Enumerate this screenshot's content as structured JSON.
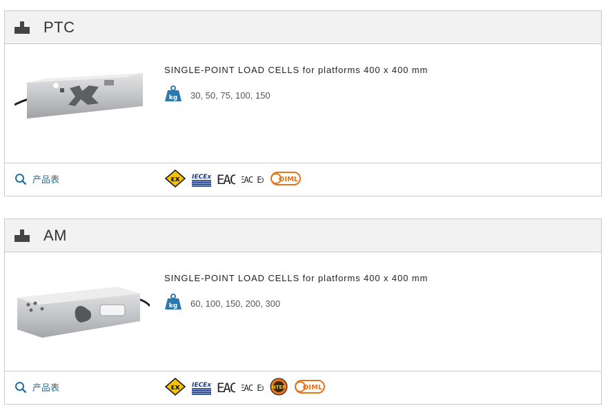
{
  "products": [
    {
      "name": "PTC",
      "description_bold": "SINGLE-POINT LOAD CELLS",
      "description_rest": " for platforms 400 x 400 mm",
      "capacity_unit": "kg",
      "capacities": "30, 50, 75, 100, 150",
      "datasheet_label": "产品表",
      "certifications": [
        "ATEX Ex",
        "IECEx",
        "EAC",
        "EAC Ex",
        "OIML"
      ]
    },
    {
      "name": "AM",
      "description_bold": "SINGLE-POINT LOAD CELLS",
      "description_rest": " for platforms 400 x 400 mm",
      "capacity_unit": "kg",
      "capacities": "60, 100, 150, 200, 300",
      "datasheet_label": "产品表",
      "certifications": [
        "ATEX Ex",
        "IECEx",
        "EAC",
        "EAC Ex",
        "NTEP",
        "OIML"
      ]
    }
  ],
  "colors": {
    "link": "#1f6fa3",
    "kg_badge": "#2a78ad",
    "atex": "#f3c300",
    "oiml": "#e8731e",
    "iecex": "#1d3c8a"
  }
}
